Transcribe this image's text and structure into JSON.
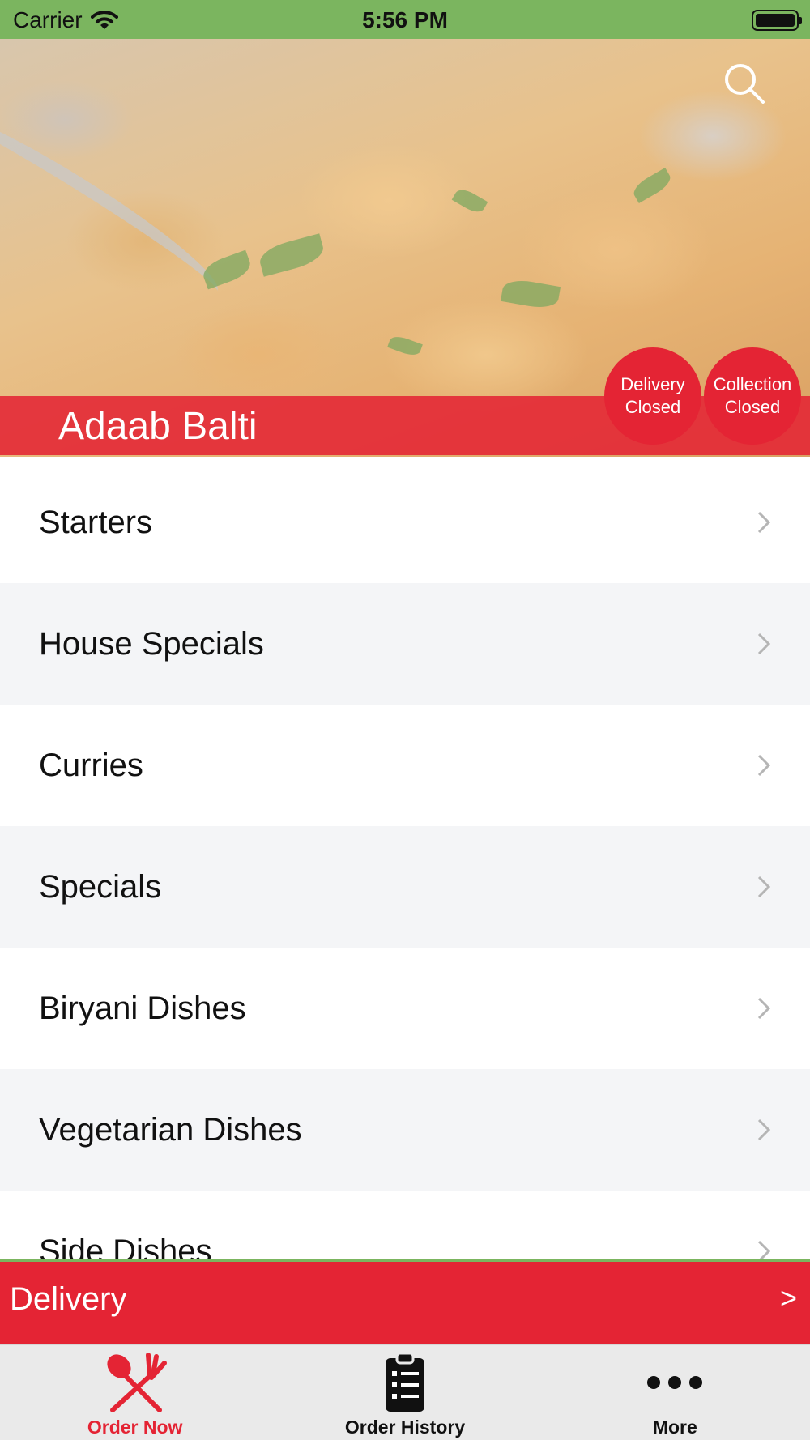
{
  "status_bar": {
    "carrier": "Carrier",
    "time": "5:56 PM"
  },
  "hero": {
    "restaurant_name": "Adaab Balti",
    "delivery_status": {
      "line1": "Delivery",
      "line2": "Closed"
    },
    "collection_status": {
      "line1": "Collection",
      "line2": "Closed"
    }
  },
  "menu": {
    "items": [
      {
        "label": "Starters"
      },
      {
        "label": "House Specials"
      },
      {
        "label": "Curries"
      },
      {
        "label": "Specials"
      },
      {
        "label": "Biryani Dishes"
      },
      {
        "label": "Vegetarian Dishes"
      },
      {
        "label": "Side Dishes"
      }
    ]
  },
  "order_bar": {
    "label": "Delivery",
    "arrow": ">"
  },
  "tab_bar": {
    "tabs": [
      {
        "label": "Order Now",
        "icon": "fork-knife-icon",
        "active": true
      },
      {
        "label": "Order History",
        "icon": "clipboard-icon",
        "active": false
      },
      {
        "label": "More",
        "icon": "more-dots-icon",
        "active": false
      }
    ]
  },
  "colors": {
    "status_green": "#7bb55f",
    "brand_red": "#e42434",
    "row_alt": "#f4f5f7"
  }
}
